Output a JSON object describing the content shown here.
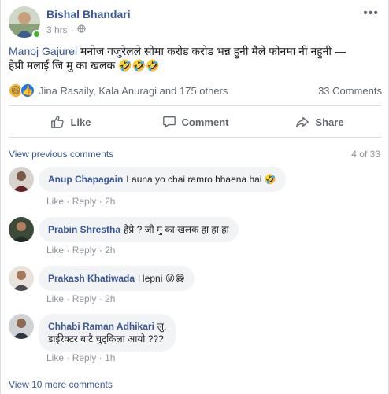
{
  "post": {
    "author": "Bishal Bhandari",
    "time": "3 hrs",
    "privacy_symbol": "·",
    "mention": "Manoj Gajurel",
    "text_line1_rest": " मनोज गजुरेलले सोमा करोड करोड भन्न हुनी मैले फोनमा नी नहुनी —",
    "text_line2": "हेप्री मलाई जि मु का खलक 🤣🤣🤣",
    "icons": {
      "menu": "more-dots-icon",
      "privacy": "globe-icon"
    }
  },
  "reactions": {
    "haha_emoji": "😆",
    "like_emoji": "👍",
    "names": "Jina Rasaily, Kala Anuragi and 175 others",
    "comments_count": "33 Comments"
  },
  "actions": {
    "like": "Like",
    "comment": "Comment",
    "share": "Share"
  },
  "comments_section": {
    "view_previous": "View previous comments",
    "count_of": "4 of 33",
    "view_more": "View 10 more comments",
    "items": [
      {
        "name": "Anup Chapagain",
        "text": "Launa yo chai ramro bhaena hai 🤣",
        "like": "Like",
        "reply": "Reply",
        "sep": "·",
        "time": "2h"
      },
      {
        "name": "Prabin Shrestha",
        "text": "हेप्रे ? जी मु का खलक हा हा हा",
        "like": "Like",
        "reply": "Reply",
        "sep": "·",
        "time": "2h"
      },
      {
        "name": "Prakash Khatiwada",
        "text": "Hepni 😜😁",
        "like": "Like",
        "reply": "Reply",
        "sep": "·",
        "time": "2h"
      },
      {
        "name": "Chhabi Raman Adhikari",
        "text": "लु,",
        "text2": "डाईरेक्टर बाटै चुट्किला आयो ???",
        "like": "Like",
        "reply": "Reply",
        "sep": "·",
        "time": "1h"
      }
    ]
  },
  "colors": {
    "link": "#385898",
    "muted": "#90949c",
    "bubble": "#f2f3f5",
    "online": "#42b72a"
  }
}
